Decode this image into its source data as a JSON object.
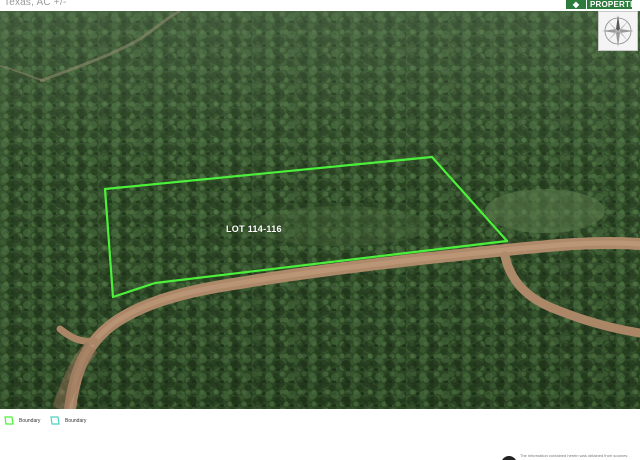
{
  "header": {
    "location": "Texas,  AC +/-",
    "brand": "PROPERTIES"
  },
  "map": {
    "lot_label": "LOT 114-116",
    "boundary_color": "#4cf03a",
    "road_color": "#b28a6a",
    "forest_color": "#2e4a26"
  },
  "legend": {
    "items": [
      {
        "label": "Boundary"
      },
      {
        "label": "Boundary"
      }
    ]
  },
  "footer": {
    "left_text": "",
    "disclaimer": "The information contained herein was obtained from sources"
  }
}
